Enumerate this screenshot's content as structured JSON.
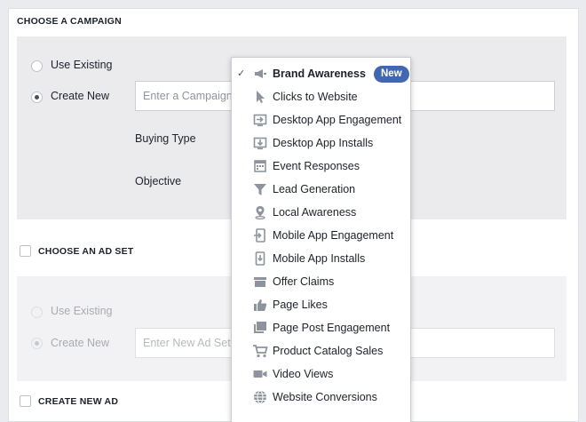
{
  "campaign": {
    "title": "CHOOSE A CAMPAIGN",
    "use_existing": "Use Existing",
    "create_new": "Create New",
    "name_placeholder": "Enter a Campaign Name",
    "buying_type": "Buying Type",
    "objective": "Objective"
  },
  "ad_set": {
    "title": "CHOOSE AN AD SET",
    "use_existing": "Use Existing",
    "create_new": "Create New",
    "name_placeholder": "Enter New Ad Set Name"
  },
  "new_ad": {
    "title": "CREATE NEW AD"
  },
  "objective_menu": {
    "selected": "Brand Awareness",
    "new_badge": "New",
    "check_glyph": "✓",
    "items": [
      {
        "label": "Brand Awareness",
        "icon": "megaphone-icon"
      },
      {
        "label": "Clicks to Website",
        "icon": "cursor-icon"
      },
      {
        "label": "Desktop App Engagement",
        "icon": "desktop-app-engage-icon"
      },
      {
        "label": "Desktop App Installs",
        "icon": "desktop-app-install-icon"
      },
      {
        "label": "Event Responses",
        "icon": "calendar-icon"
      },
      {
        "label": "Lead Generation",
        "icon": "funnel-icon"
      },
      {
        "label": "Local Awareness",
        "icon": "location-pin-icon"
      },
      {
        "label": "Mobile App Engagement",
        "icon": "mobile-engage-icon"
      },
      {
        "label": "Mobile App Installs",
        "icon": "mobile-install-icon"
      },
      {
        "label": "Offer Claims",
        "icon": "offer-icon"
      },
      {
        "label": "Page Likes",
        "icon": "thumbs-up-icon"
      },
      {
        "label": "Page Post Engagement",
        "icon": "post-icon"
      },
      {
        "label": "Product Catalog Sales",
        "icon": "cart-icon"
      },
      {
        "label": "Video Views",
        "icon": "video-camera-icon"
      },
      {
        "label": "Website Conversions",
        "icon": "globe-icon"
      }
    ]
  },
  "colors": {
    "accent": "#4267b2",
    "page_bg": "#e9ebee",
    "section_bg": "#ebebee",
    "icon_grey": "#8d949e"
  }
}
